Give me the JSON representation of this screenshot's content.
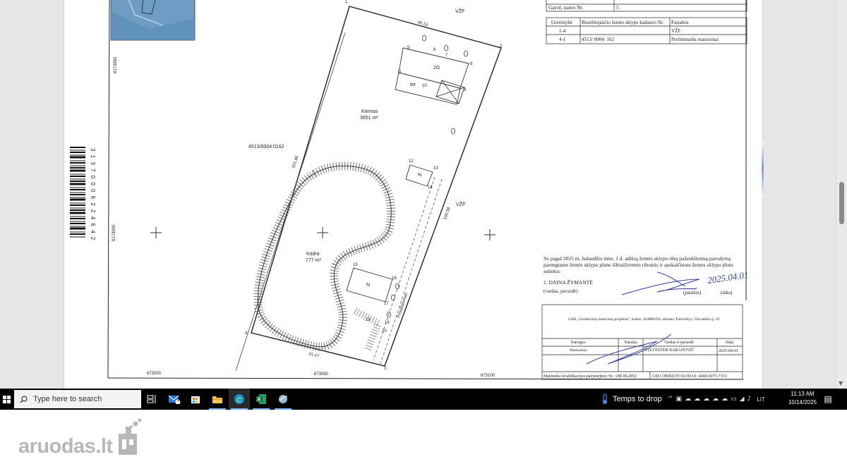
{
  "plan": {
    "neighbors_table": {
      "row_street_label": "Gatvė, namo Nr.",
      "row_street_value": "5",
      "headers": [
        "Gretimybė",
        "Besiribojančio žemės sklypo kadastro Nr.",
        "Pastabos"
      ],
      "rows": [
        [
          "1-4",
          "",
          "VŽF"
        ],
        [
          "4-1",
          "4513/ 0004: 162",
          "Preliminarūs matavimai"
        ]
      ]
    },
    "labels": {
      "kiemas": "Kiemas",
      "kiemas_area": "3651 m²",
      "kudra": "Kūdra",
      "kudra_area": "777 m²",
      "neighbor_parcel": "4513/0004:0162",
      "vzf_top": "VŽF",
      "vzf_right": "VŽF",
      "building_2g": "2G",
      "ter": "ter",
      "n_upper": "N",
      "n_lower": "N",
      "side_top": "46.13",
      "side_left": "101.86",
      "side_right": "100.59",
      "side_bottom": "41.47",
      "road": "Privažiavimas",
      "grid_x1": "673000",
      "grid_x2": "673050",
      "grid_x3": "673100",
      "grid_y1": "6173950",
      "grid_y2": "6173900",
      "barcode_digits": "3 1 3 7 0 0 0 6 2 2 4 6 4 2"
    },
    "points": [
      "1",
      "2",
      "3",
      "4",
      "5",
      "6",
      "7",
      "8",
      "9",
      "10",
      "11",
      "12",
      "13",
      "14",
      "15",
      "16",
      "17",
      "18",
      "19",
      "20"
    ],
    "consent": {
      "text": "Su pagal 2025 m. balandžio mėn. 1 d. atliktą žemės sklypo ribų paženklinimą-parodymą parengtame žemės sklypo plane išbraižytomis ribomis ir apskaičiuotu žemės sklypo plotu sutinku:",
      "line1": "Su pagal 2025 m. balandžio mėn. 1 d. atliktą žemės sklypo ribų paženklinimą-parodymą",
      "line2": "parengtame žemės sklypo plane išbraižytomis ribomis ir apskaičiuotu žemės sklypo plotu",
      "line3": "sutinku:",
      "person": "1. DAINA ŽYMANTĖ",
      "name_caption": "(vardas, pavardė)",
      "signature_caption": "(parašas)",
      "date_caption": "(data)",
      "handwritten_date": "2025.04.01"
    },
    "title_block": {
      "company": "UAB „Geodezinių matavimų projektai\", kodas: 304080356, adresas: Panevėžys, Vaivadeliu g. 10",
      "col_position": "Pareigos",
      "col_signature": "Parašas",
      "col_name": "Vardas ir pavardė",
      "col_date": "Data",
      "position_value": "Matininkas",
      "name_value": "SYLVESTER BARANOVIČ",
      "date_value": "2025-04-01",
      "license": "Matininko kvalifikacijos pažymėjimo Nr.: 2M-M-2852",
      "geo_code": "GEO OBJEKTO KODAS: 4400-0275-7151"
    }
  },
  "taskbar": {
    "search_placeholder": "Type here to search",
    "weather_text": "Temps to drop",
    "language": "LIT",
    "time": "11:13 AM",
    "date": "10/14/2025",
    "mail_badge": "1"
  },
  "watermark": {
    "brand": "aruodas.lt"
  }
}
